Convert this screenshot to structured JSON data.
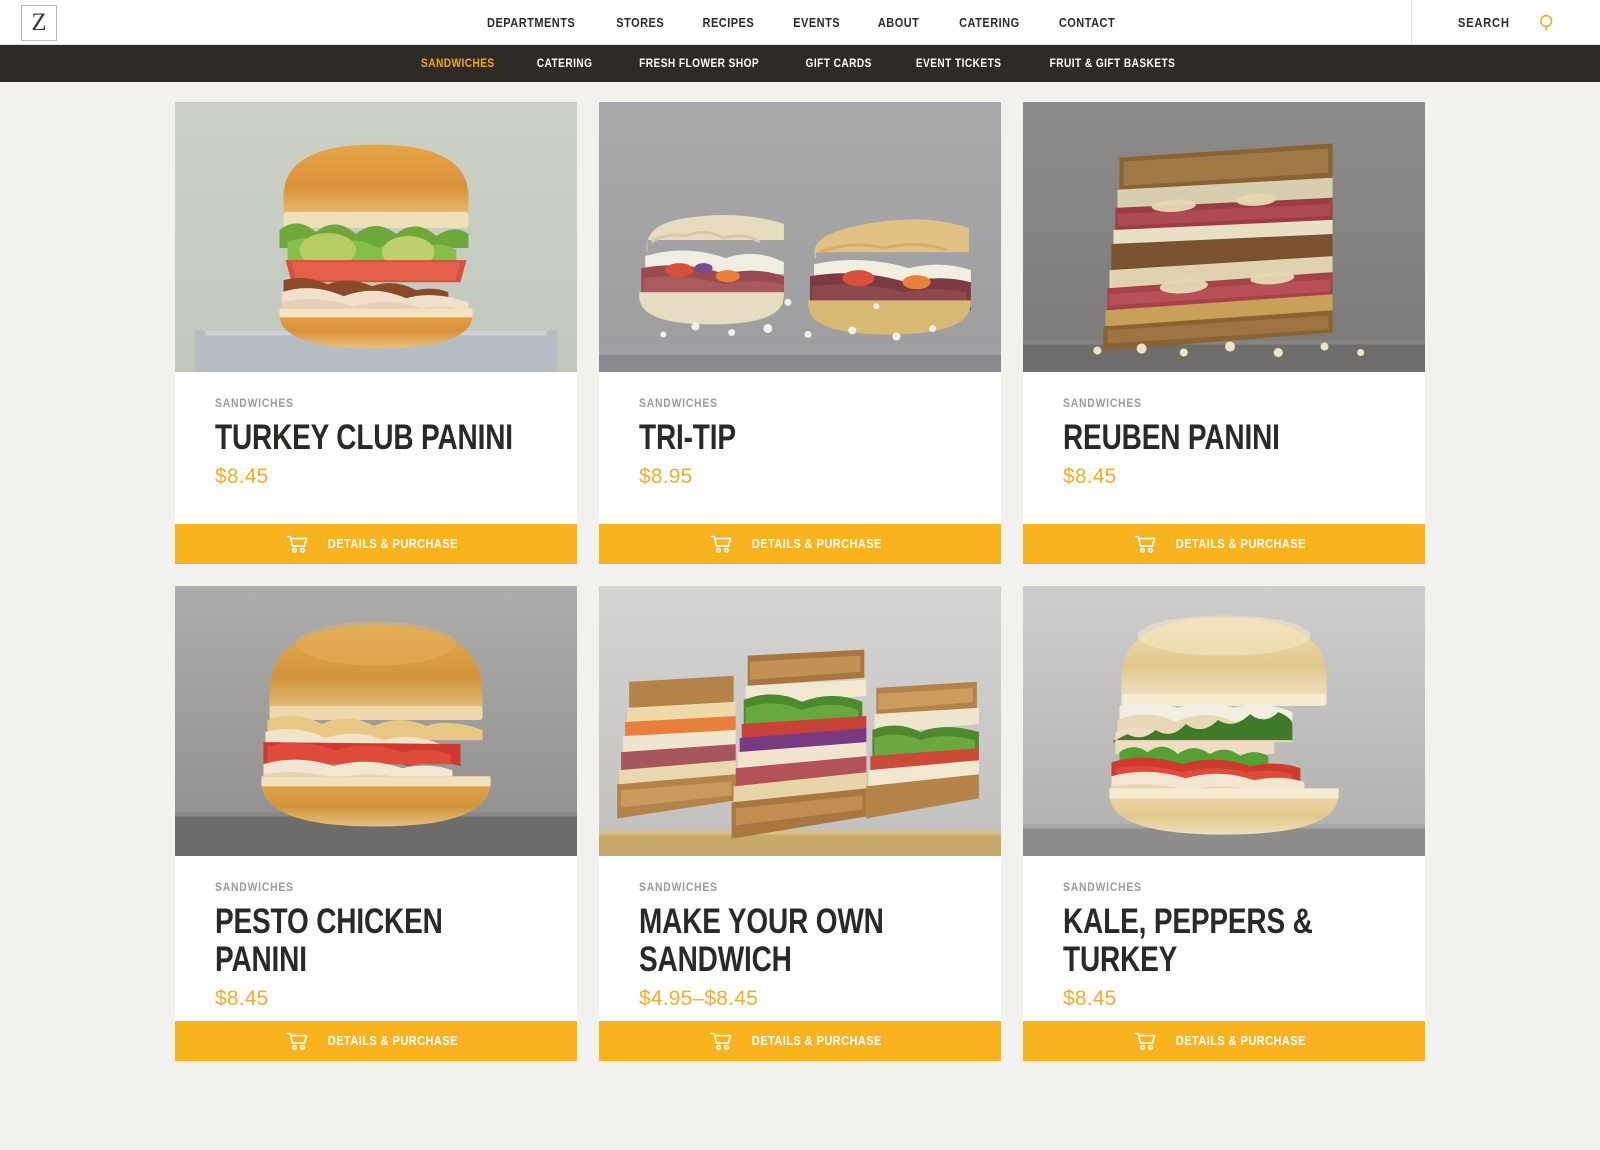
{
  "header": {
    "logo_letter": "Z",
    "nav": [
      {
        "label": "DEPARTMENTS"
      },
      {
        "label": "STORES"
      },
      {
        "label": "RECIPES"
      },
      {
        "label": "EVENTS"
      },
      {
        "label": "ABOUT"
      },
      {
        "label": "CATERING"
      },
      {
        "label": "CONTACT"
      }
    ],
    "search_label": "SEARCH"
  },
  "subnav": {
    "items": [
      {
        "label": "SANDWICHES",
        "active": true
      },
      {
        "label": "CATERING",
        "active": false
      },
      {
        "label": "FRESH FLOWER SHOP",
        "active": false
      },
      {
        "label": "GIFT CARDS",
        "active": false
      },
      {
        "label": "EVENT TICKETS",
        "active": false
      },
      {
        "label": "FRUIT & GIFT BASKETS",
        "active": false
      }
    ]
  },
  "colors": {
    "accent_gold": "#f9b31f",
    "price_gold": "#efaf2b",
    "dark_nav": "#2e2b26",
    "page_bg": "#f2f1ed",
    "card_bg": "#ffffff",
    "category_gray": "#9b9b97"
  },
  "button_label": "DETAILS & PURCHASE",
  "products": [
    {
      "category": "SANDWICHES",
      "title": "TURKEY CLUB PANINI",
      "price": "$8.45",
      "button": "DETAILS & PURCHASE",
      "photo": "turkey-club-panini-photo"
    },
    {
      "category": "SANDWICHES",
      "title": "TRI-TIP",
      "price": "$8.95",
      "button": "DETAILS & PURCHASE",
      "photo": "tri-tip-photo"
    },
    {
      "category": "SANDWICHES",
      "title": "REUBEN PANINI",
      "price": "$8.45",
      "button": "DETAILS & PURCHASE",
      "photo": "reuben-panini-photo"
    },
    {
      "category": "SANDWICHES",
      "title": "PESTO CHICKEN PANINI",
      "price": "$8.45",
      "button": "DETAILS & PURCHASE",
      "photo": "pesto-chicken-panini-photo"
    },
    {
      "category": "SANDWICHES",
      "title": "MAKE YOUR OWN SANDWICH",
      "price": "$4.95–$8.45",
      "button": "DETAILS & PURCHASE",
      "photo": "make-your-own-sandwich-photo"
    },
    {
      "category": "SANDWICHES",
      "title": "KALE, PEPPERS & TURKEY",
      "price": "$8.45",
      "button": "DETAILS & PURCHASE",
      "photo": "kale-peppers-turkey-photo"
    }
  ]
}
